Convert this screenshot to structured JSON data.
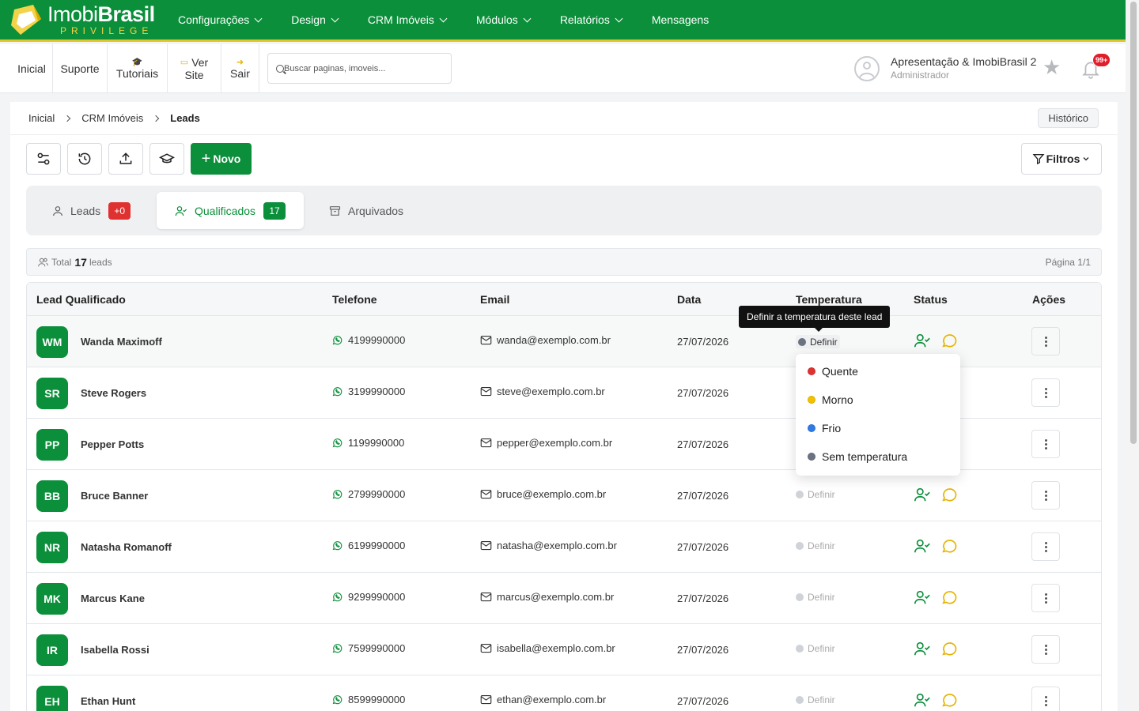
{
  "brand": {
    "name_light": "Imobi",
    "name_bold": "Brasil",
    "tagline": "PRIVILEGE"
  },
  "nav": [
    {
      "label": "Configurações",
      "dropdown": true
    },
    {
      "label": "Design",
      "dropdown": true
    },
    {
      "label": "CRM Imóveis",
      "dropdown": true
    },
    {
      "label": "Módulos",
      "dropdown": true
    },
    {
      "label": "Relatórios",
      "dropdown": true
    },
    {
      "label": "Mensagens",
      "dropdown": false
    }
  ],
  "subbar": {
    "inicial": "Inicial",
    "suporte": "Suporte",
    "tutoriais": "Tutoriais",
    "ver": "Ver",
    "site": "Site",
    "sair": "Sair",
    "search_placeholder": "Buscar paginas, imoveis..."
  },
  "user": {
    "name": "Apresentação & ImobiBrasil 2",
    "role": "Administrador",
    "notifications": "99+"
  },
  "breadcrumb": {
    "items": [
      "Inicial",
      "CRM Imóveis"
    ],
    "current": "Leads",
    "history_button": "Histórico"
  },
  "toolbar": {
    "new_label": "Novo",
    "filters_label": "Filtros"
  },
  "tabs": [
    {
      "label": "Leads",
      "count": "+0",
      "count_color": "#e03131"
    },
    {
      "label": "Qualificados",
      "count": "17",
      "count_color": "#0b8f3a"
    },
    {
      "label": "Arquivados"
    }
  ],
  "summary": {
    "prefix": "Total",
    "count": "17",
    "suffix": "leads",
    "page": "Página 1/1"
  },
  "table": {
    "columns": [
      "Lead Qualificado",
      "Telefone",
      "Email",
      "Data",
      "Temperatura",
      "Status",
      "Ações"
    ],
    "temp_placeholder": "Definir",
    "rows": [
      {
        "initials": "WM",
        "name": "Wanda Maximoff",
        "phone": "4199990000",
        "email": "wanda@exemplo.com.br",
        "date": "27/07/2026"
      },
      {
        "initials": "SR",
        "name": "Steve Rogers",
        "phone": "3199990000",
        "email": "steve@exemplo.com.br",
        "date": "27/07/2026"
      },
      {
        "initials": "PP",
        "name": "Pepper Potts",
        "phone": "1199990000",
        "email": "pepper@exemplo.com.br",
        "date": "27/07/2026"
      },
      {
        "initials": "BB",
        "name": "Bruce Banner",
        "phone": "2799990000",
        "email": "bruce@exemplo.com.br",
        "date": "27/07/2026"
      },
      {
        "initials": "NR",
        "name": "Natasha Romanoff",
        "phone": "6199990000",
        "email": "natasha@exemplo.com.br",
        "date": "27/07/2026"
      },
      {
        "initials": "MK",
        "name": "Marcus Kane",
        "phone": "9299990000",
        "email": "marcus@exemplo.com.br",
        "date": "27/07/2026"
      },
      {
        "initials": "IR",
        "name": "Isabella Rossi",
        "phone": "7599990000",
        "email": "isabella@exemplo.com.br",
        "date": "27/07/2026"
      },
      {
        "initials": "EH",
        "name": "Ethan Hunt",
        "phone": "8599990000",
        "email": "ethan@exemplo.com.br",
        "date": "27/07/2026"
      }
    ]
  },
  "tooltip": "Definir a temperatura deste lead",
  "temperature_options": [
    {
      "label": "Quente",
      "color": "#e03131"
    },
    {
      "label": "Morno",
      "color": "#f2c200"
    },
    {
      "label": "Frio",
      "color": "#2f7ae5"
    },
    {
      "label": "Sem temperatura",
      "color": "#6b7280"
    }
  ],
  "colors": {
    "brand_green": "#0b8f3a",
    "brand_yellow": "#e2c52a",
    "whatsapp": "#0b8f3a",
    "chat": "#e6b400"
  }
}
